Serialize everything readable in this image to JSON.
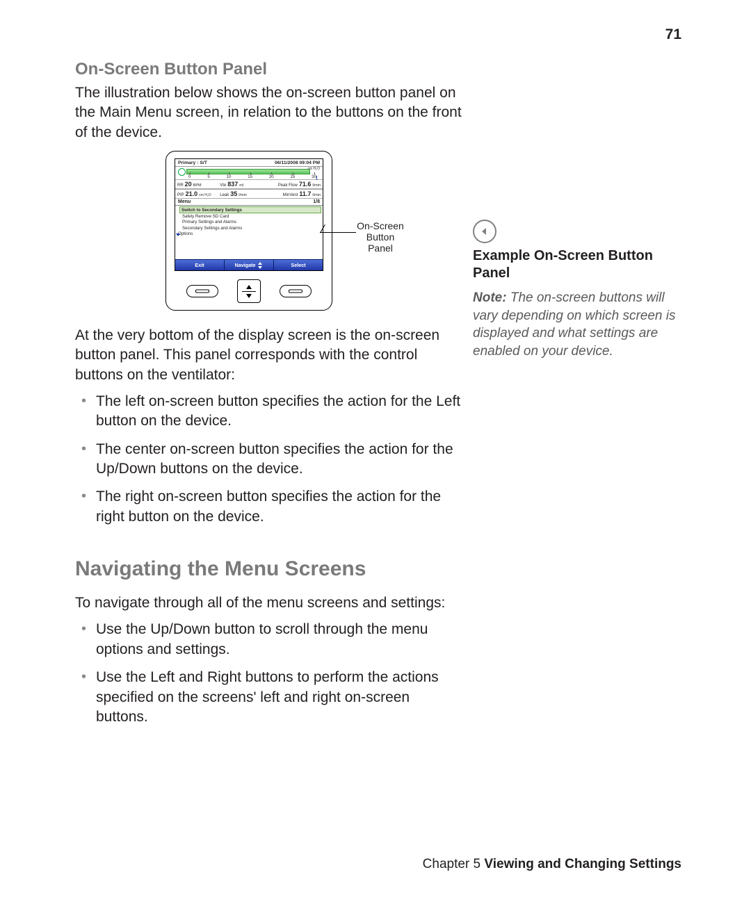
{
  "page_number": "71",
  "section1": {
    "heading": "On-Screen Button Panel",
    "intro": "The illustration below shows the on-screen button panel on the Main Menu screen, in relation to the buttons on the front of the device.",
    "after_illus": "At the very bottom of the display screen is the on-screen button panel. This panel corresponds with the control buttons on the ventilator:",
    "bullets": [
      "The left on-screen button specifies the action for the Left button on the device.",
      "The center on-screen button specifies the action for the Up/Down buttons on the device.",
      "The right on-screen button specifies the action for the right button on the device."
    ]
  },
  "section2": {
    "heading": "Navigating the Menu Screens",
    "intro": "To navigate through all of the menu screens and settings:",
    "bullets": [
      "Use the Up/Down button to scroll through the menu options and settings.",
      "Use the Left and Right buttons to perform the actions specified on the screens' left and right on-screen buttons."
    ]
  },
  "sidebar": {
    "caption": "Example On-Screen Button Panel",
    "note_label": "Note:",
    "note_body": "The on-screen buttons will vary depending on which screen is displayed and what settings are enabled on your device."
  },
  "footer": {
    "chapter": "Chapter 5",
    "title": "Viewing and Changing Settings"
  },
  "illustration": {
    "callout": "On-Screen Button Panel",
    "screen": {
      "mode": "Primary : S/T",
      "datetime": "06/11/2008 09:04 PM",
      "h2o_label": "cm H₂O",
      "scale": [
        "0",
        "5",
        "10",
        "15",
        "20",
        "25",
        "30"
      ],
      "row1": {
        "rr_label": "RR",
        "rr_val": "20",
        "rr_unit": "BPM",
        "vte_label": "Vte",
        "vte_val": "837",
        "vte_unit": "ml",
        "pf_label": "Peak Flow",
        "pf_val": "71.6",
        "pf_unit": "l/min"
      },
      "row2": {
        "pip_label": "PIP",
        "pip_val": "21.0",
        "pip_unit": "cm H₂O",
        "leak_label": "Leak",
        "leak_val": "35",
        "leak_unit": "l/min",
        "mv_label": "MinVent",
        "mv_val": "11.7",
        "mv_unit": "l/min"
      },
      "menu_header": "Menu",
      "menu_page": "1/8",
      "menu_items": [
        "Switch to Secondary Settings",
        "Safely Remove SD Card",
        "Primary Settings and Alarms",
        "Secondary Settings and Alarms",
        "Options"
      ],
      "softkeys": {
        "left": "Exit",
        "center": "Navigate",
        "right": "Select"
      }
    }
  }
}
